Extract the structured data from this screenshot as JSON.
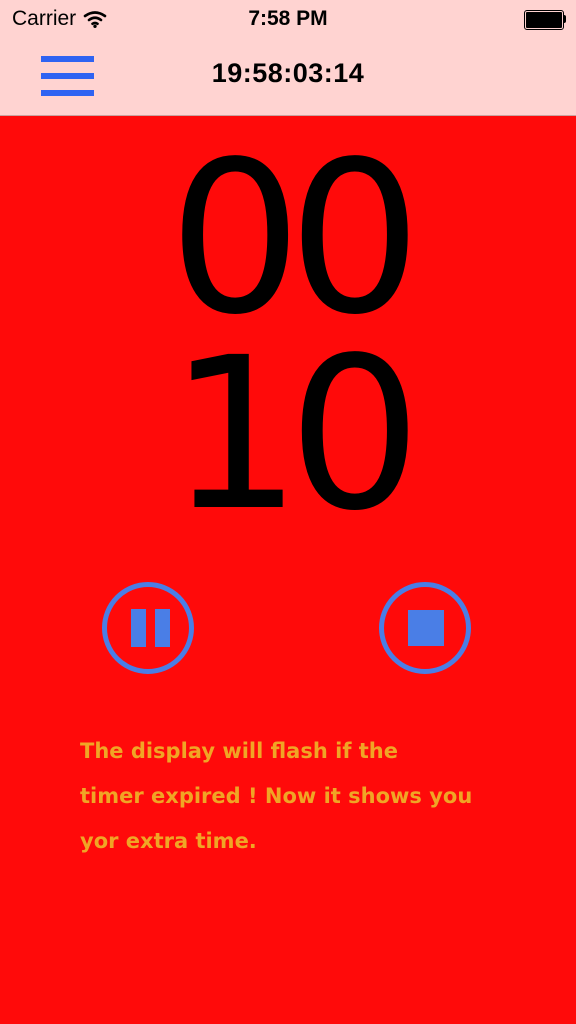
{
  "status_bar": {
    "carrier": "Carrier",
    "time": "7:58 PM",
    "wifi_icon": "wifi-icon",
    "battery_icon": "battery-icon"
  },
  "nav": {
    "menu_icon": "hamburger-menu-icon",
    "clock": "19:58:03:14"
  },
  "timer": {
    "minutes": "00",
    "seconds": "10"
  },
  "controls": {
    "pause_icon": "pause-icon",
    "stop_icon": "stop-icon"
  },
  "info": {
    "lines": [
      "The display will flash if the",
      "timer expired ! Now it shows you",
      "yor extra time."
    ]
  },
  "colors": {
    "background": "#ff0a0a",
    "top_bar": "#ffd3d1",
    "menu_icon": "#2f63f2",
    "control_accent": "#4a7ee6",
    "info_text": "#f0a525",
    "digits": "#000000"
  }
}
